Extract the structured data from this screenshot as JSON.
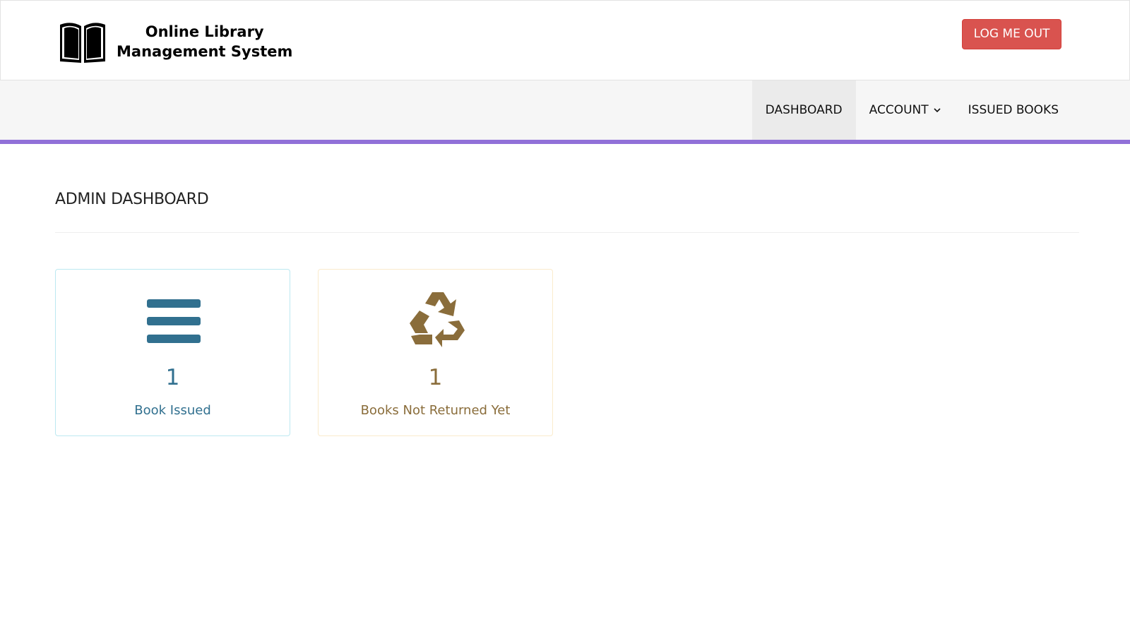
{
  "header": {
    "logo_line1": "Online Library",
    "logo_line2": "Management System",
    "logout_label": "LOG ME OUT"
  },
  "nav": {
    "items": [
      {
        "label": "DASHBOARD",
        "active": true
      },
      {
        "label": "ACCOUNT",
        "has_dropdown": true
      },
      {
        "label": "ISSUED BOOKS"
      }
    ]
  },
  "page": {
    "title": "ADMIN DASHBOARD"
  },
  "cards": [
    {
      "count": "1",
      "label": "Book Issued",
      "icon": "bars-icon",
      "color": "#31708f"
    },
    {
      "count": "1",
      "label": "Books Not Returned Yet",
      "icon": "recycle-icon",
      "color": "#8a6d3b"
    }
  ],
  "colors": {
    "logout_button": "#d9534f",
    "nav_accent": "#9170d8",
    "navbar_bg": "#f6f6f6",
    "info_text": "#31708f",
    "info_icon": "#31708f",
    "warning_text": "#8a6d3b",
    "warning_icon": "#8a6d3b"
  }
}
